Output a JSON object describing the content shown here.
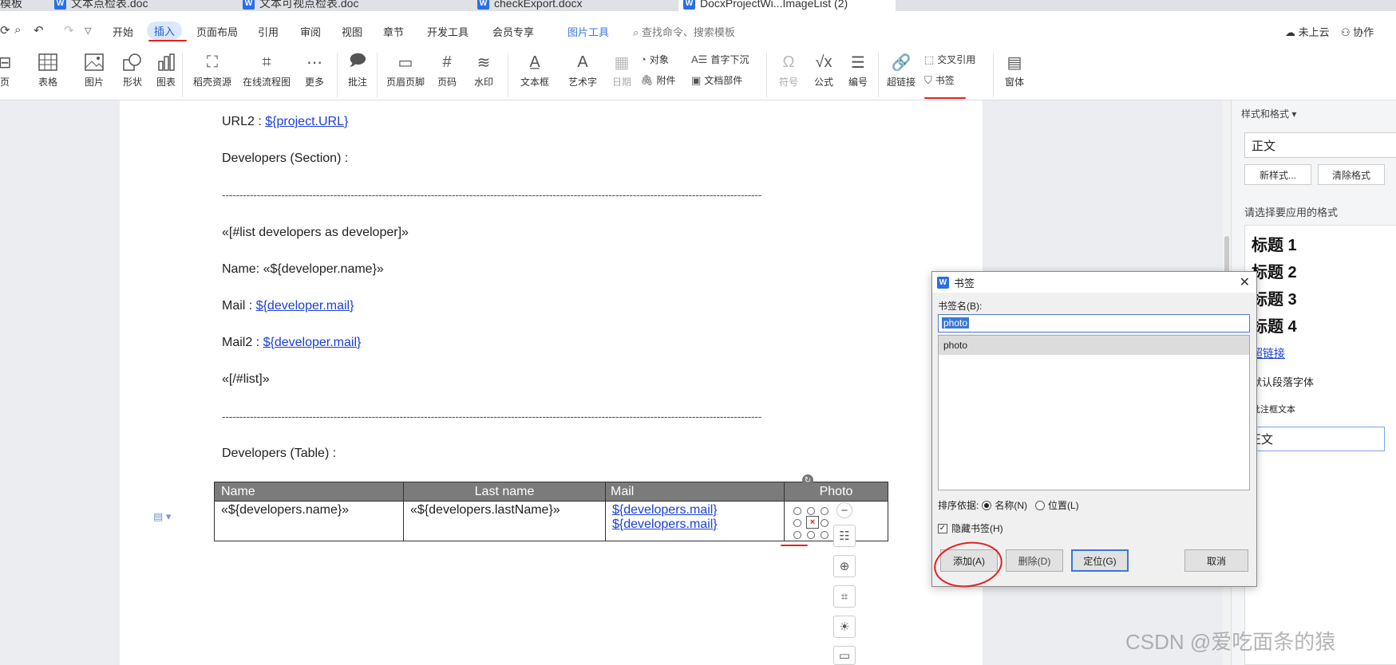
{
  "tabs": [
    {
      "label": "模板"
    },
    {
      "label": "文本点检表.doc"
    },
    {
      "label": "文本可视点检表.doc"
    },
    {
      "label": "checkExport.docx"
    },
    {
      "label": "DocxProjectWi...ImageList (2)"
    }
  ],
  "menu": {
    "items": [
      "开始",
      "插入",
      "页面布局",
      "引用",
      "审阅",
      "视图",
      "章节",
      "开发工具",
      "会员专享",
      "图片工具"
    ],
    "search_placeholder": "查找命令、搜索模板",
    "cloud": "未上云",
    "collab": "协作"
  },
  "ribbon": {
    "page": "页",
    "table": "表格",
    "picture": "图片",
    "shape": "形状",
    "chart": "图表",
    "resources": "稻壳资源",
    "flowchart": "在线流程图",
    "more": "更多",
    "comment": "批注",
    "header_footer": "页眉页脚",
    "page_num": "页码",
    "watermark": "水印",
    "textbox": "文本框",
    "wordart": "艺术字",
    "date": "日期",
    "object": "对象",
    "attachment": "附件",
    "dropcap": "首字下沉",
    "docpart": "文档部件",
    "symbol": "符号",
    "formula": "公式",
    "numbering": "编号",
    "hyperlink": "超链接",
    "crossref": "交叉引用",
    "bookmark": "书签",
    "window": "窗体"
  },
  "doc": {
    "url2_label": "URL2 : ",
    "url2_link": "${project.URL}",
    "dev_section": "Developers (Section) :",
    "dashes": "-----------------------------------------------------------------------------------------------------------------------------------------------------------",
    "list_start": "«[#list developers as developer]»",
    "name_line": "Name: «${developer.name}»",
    "mail_label": "Mail : ",
    "mail_link": "${developer.mail}",
    "mail2_label": "Mail2 : ",
    "mail2_link": "${developer.mail}",
    "list_end": "«[/#list]»",
    "dev_table": "Developers (Table) :",
    "table": {
      "headers": [
        "Name",
        "Last name",
        "Mail",
        "Photo"
      ],
      "row": {
        "name": "«${developers.name}»",
        "last": "«${developers.lastName}»",
        "mail1": "${developers.mail}",
        "mail2": "${developers.mail}"
      }
    }
  },
  "pane": {
    "title": "样式和格式",
    "current": "正文",
    "new_style": "新样式...",
    "clear_format": "清除格式",
    "choose": "请选择要应用的格式",
    "styles": [
      "标题 1",
      "标题 2",
      "标题 3",
      "标题 4"
    ],
    "link": "超链接",
    "default_font": "默认段落字体",
    "annot": "批注框文本",
    "body": "正文"
  },
  "dialog": {
    "title": "书签",
    "name_label": "书签名(B):",
    "name_value": "photo",
    "list": [
      "photo"
    ],
    "sort_label": "排序依据:",
    "sort_name": "名称(N)",
    "sort_pos": "位置(L)",
    "hide": "隐藏书签(H)",
    "add": "添加(A)",
    "delete": "删除(D)",
    "goto": "定位(G)",
    "cancel": "取消"
  },
  "watermark": "CSDN @爱吃面条的猿"
}
